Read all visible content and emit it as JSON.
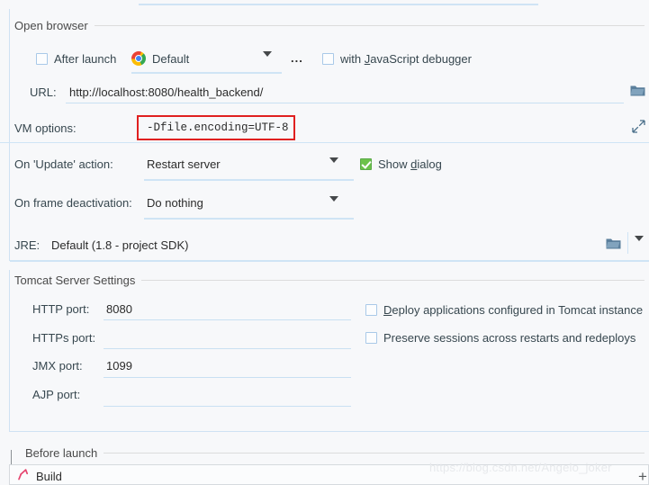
{
  "app": {
    "context": "IntelliJ IDEA Run/Debug Configurations - Tomcat Server - Startup/Connection"
  },
  "open_browser": {
    "section_title": "Open browser",
    "after_launch": {
      "label": "After launch",
      "checked": false
    },
    "browser": {
      "value": "Default",
      "icon": "chrome-icon"
    },
    "more_button_label": "...",
    "js_debugger": {
      "label_prefix": "with ",
      "label_mnemonic": "J",
      "label_suffix": "avaScript debugger",
      "checked": false
    }
  },
  "url": {
    "label": "URL:",
    "value": "http://localhost:8080/health_backend/",
    "browse_icon": "folder-icon"
  },
  "vm_options": {
    "label": "VM options:",
    "value": "-Dfile.encoding=UTF-8",
    "highlight_color": "#e02020",
    "expand_icon": "expand-arrows-icon"
  },
  "on_update_action": {
    "label": "On 'Update' action:",
    "value": "Restart server",
    "show_dialog": {
      "label_prefix": "Show ",
      "label_mnemonic": "d",
      "label_suffix": "ialog",
      "checked": true,
      "checked_color": "#6cc24a"
    }
  },
  "on_frame_deactivation": {
    "label": "On frame deactivation:",
    "value": "Do nothing"
  },
  "jre": {
    "label": "JRE:",
    "value": "Default (1.8 - project SDK)",
    "browse_icon": "folder-icon",
    "dropdown_icon": "chevron-down-icon"
  },
  "tomcat_server_settings": {
    "section_title": "Tomcat Server Settings",
    "ports": [
      {
        "label": "HTTP port:",
        "value": "8080"
      },
      {
        "label": "HTTPs port:",
        "value": ""
      },
      {
        "label": "JMX port:",
        "value": "1099"
      },
      {
        "label": "AJP port:",
        "value": ""
      }
    ],
    "checkboxes": [
      {
        "label_prefix": "",
        "label_mnemonic": "D",
        "label_suffix": "eploy applications configured in Tomcat instance",
        "checked": false
      },
      {
        "label_prefix": "Preserve sessions across restarts and redeploys",
        "label_mnemonic": "",
        "label_suffix": "",
        "checked": false
      }
    ]
  },
  "before_launch": {
    "section_title": "Before launch",
    "collapse_icon": "chevron-down-icon",
    "items": [
      {
        "label": "Build",
        "icon": "hammer-icon"
      }
    ],
    "add_button_label": "+"
  },
  "watermark": {
    "text": "https://blog.csdn.net/Angelo_joker"
  }
}
